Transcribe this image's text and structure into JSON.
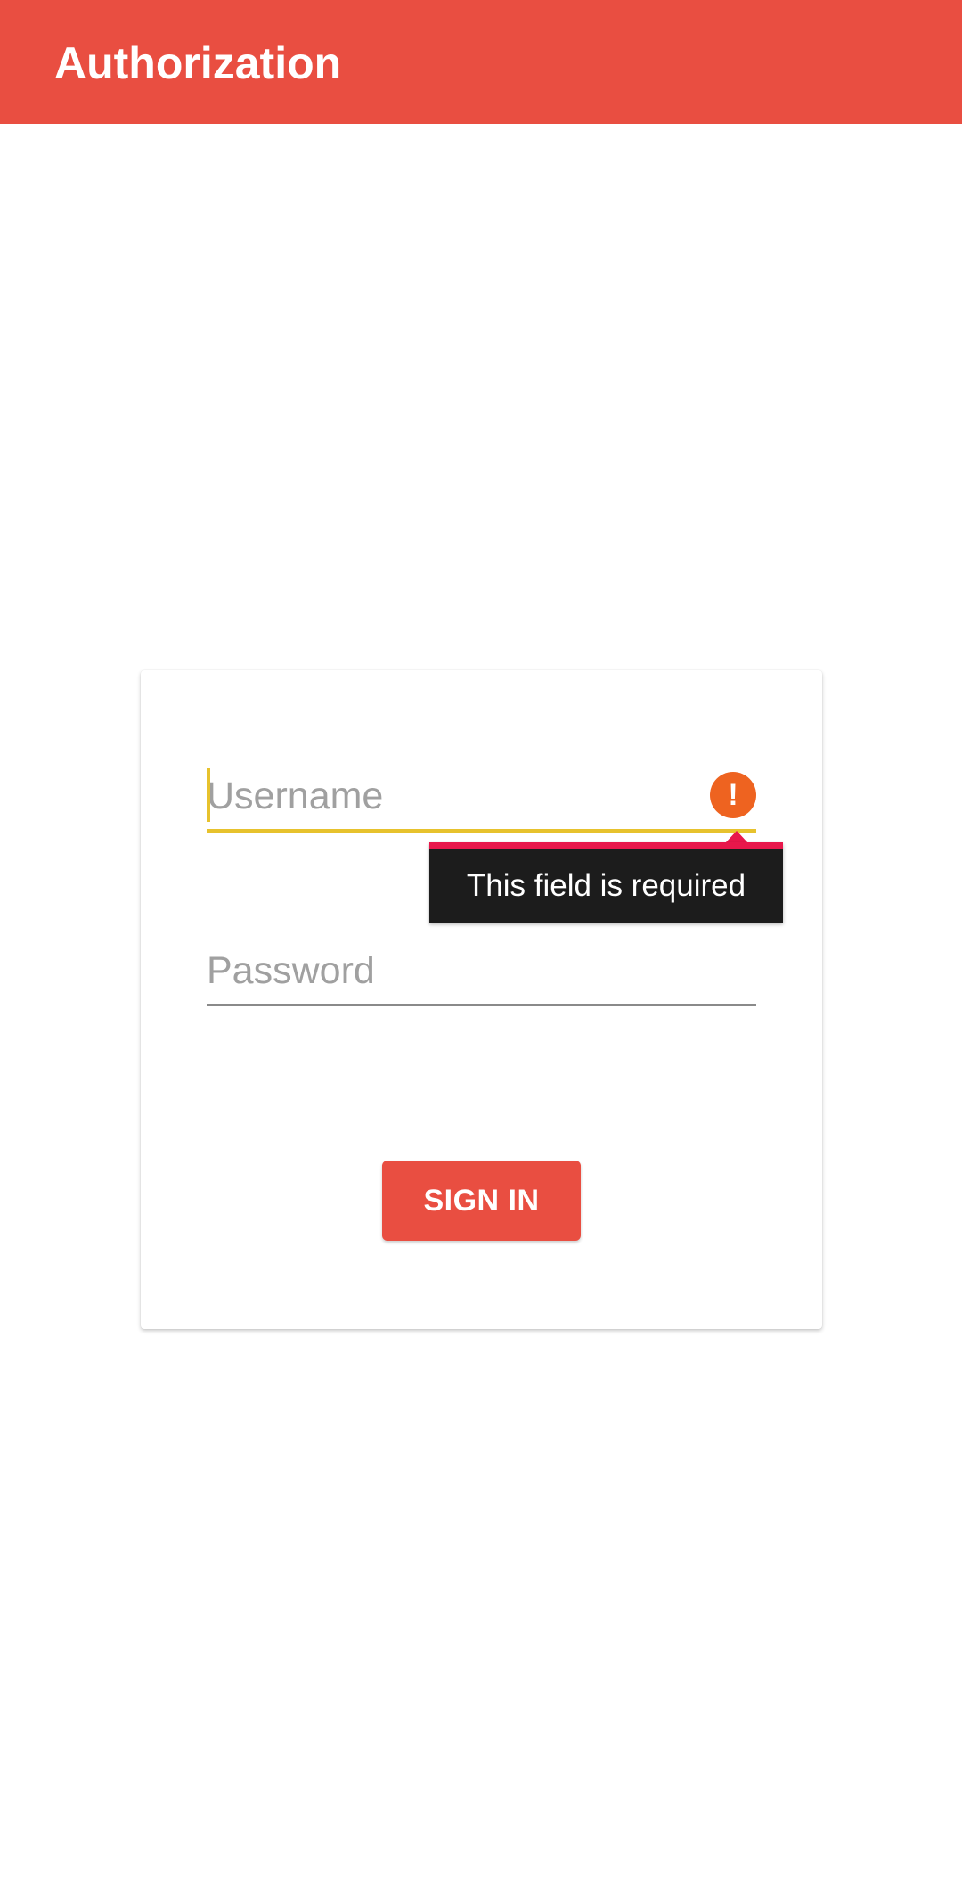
{
  "app_bar": {
    "title": "Authorization",
    "color": "#e94e41"
  },
  "form": {
    "username": {
      "placeholder": "Username",
      "value": "",
      "error_icon": "exclamation-circle-icon",
      "error_message": "This field is required",
      "state": "focused-error"
    },
    "password": {
      "placeholder": "Password",
      "value": ""
    },
    "signin_label": "SIGN IN"
  },
  "colors": {
    "accent": "#e94e41",
    "focus_underline": "#e7c22d",
    "error_icon": "#ee6320",
    "tooltip_bg": "#1c1c1c",
    "tooltip_border": "#e8174b"
  }
}
